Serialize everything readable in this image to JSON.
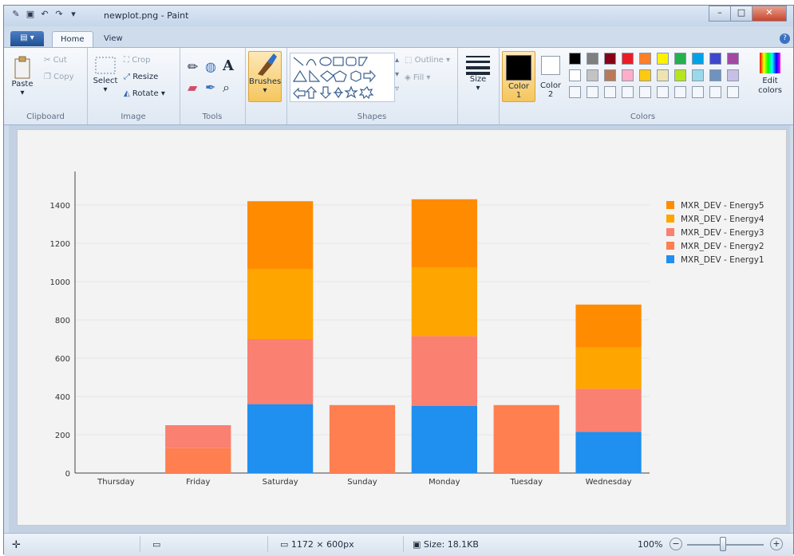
{
  "window": {
    "title": "newplot.png - Paint",
    "tabs": [
      "Home",
      "View"
    ]
  },
  "ribbon": {
    "clipboard": {
      "paste": "Paste",
      "cut": "Cut",
      "copy": "Copy",
      "label": "Clipboard"
    },
    "image": {
      "select": "Select",
      "crop": "Crop",
      "resize": "Resize",
      "rotate": "Rotate",
      "label": "Image"
    },
    "tools": {
      "label": "Tools",
      "text_tool": "A"
    },
    "brushes": {
      "label": "Brushes"
    },
    "shapes": {
      "outline": "Outline",
      "fill": "Fill",
      "label": "Shapes"
    },
    "size": {
      "label": "Size"
    },
    "colors": {
      "color1": "Color",
      "color1_num": "1",
      "color2": "Color",
      "color2_num": "2",
      "edit": "Edit colors",
      "label": "Colors",
      "palette_row1": [
        "#000000",
        "#7f7f7f",
        "#880015",
        "#ed1c24",
        "#ff7f27",
        "#fff200",
        "#22b14c",
        "#00a2e8",
        "#3f48cc",
        "#a349a4"
      ],
      "palette_row2": [
        "#ffffff",
        "#c3c3c3",
        "#b97a57",
        "#ffaec9",
        "#ffc90e",
        "#efe4b0",
        "#b5e61d",
        "#99d9ea",
        "#7092be",
        "#c8bfe7"
      ]
    }
  },
  "statusbar": {
    "dimensions": "1172 × 600px",
    "size": "Size: 18.1KB",
    "zoom": "100%"
  },
  "chart_data": {
    "type": "bar",
    "stacked": true,
    "categories": [
      "Thursday",
      "Friday",
      "Saturday",
      "Sunday",
      "Monday",
      "Tuesday",
      "Wednesday"
    ],
    "ylim": [
      0,
      1500
    ],
    "yticks": [
      0,
      200,
      400,
      600,
      800,
      1000,
      1200,
      1400
    ],
    "grid": true,
    "legend_position": "top-right",
    "series": [
      {
        "name": "MXR_DEV - Energy1",
        "color": "#1f8ff0",
        "values": [
          0,
          0,
          360,
          0,
          350,
          0,
          215
        ]
      },
      {
        "name": "MXR_DEV - Energy2",
        "color": "#ff7f50",
        "values": [
          0,
          130,
          0,
          355,
          0,
          355,
          0
        ]
      },
      {
        "name": "MXR_DEV - Energy3",
        "color": "#fa8072",
        "values": [
          0,
          120,
          340,
          0,
          365,
          0,
          225
        ]
      },
      {
        "name": "MXR_DEV - Energy4",
        "color": "#ffa500",
        "values": [
          0,
          0,
          365,
          0,
          360,
          0,
          215
        ]
      },
      {
        "name": "MXR_DEV - Energy5",
        "color": "#ff8c00",
        "values": [
          0,
          0,
          355,
          0,
          355,
          0,
          225
        ]
      }
    ]
  }
}
